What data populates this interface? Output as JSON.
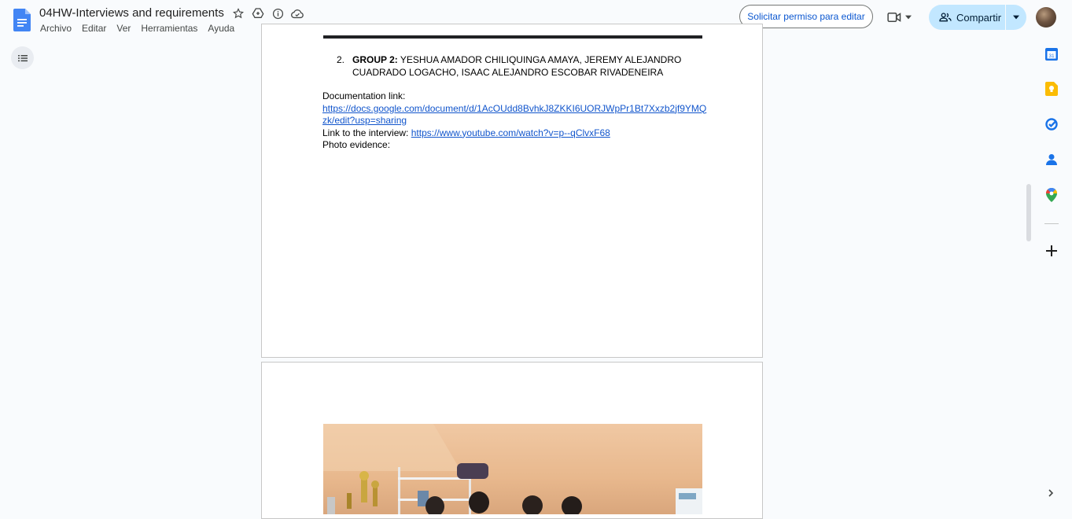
{
  "doc": {
    "title": "04HW-Interviews and requirements"
  },
  "menu": [
    "Archivo",
    "Editar",
    "Ver",
    "Herramientas",
    "Ayuda"
  ],
  "toolbar": {
    "request_edit_label": "Solicitar permiso para editar",
    "share_label": "Compartir"
  },
  "content": {
    "list_number": "2.",
    "group_label": "GROUP 2:",
    "group_members": "YESHUA AMADOR CHILIQUINGA AMAYA, JEREMY ALEJANDRO CUADRADO LOGACHO, ISAAC ALEJANDRO ESCOBAR RIVADENEIRA",
    "documentation_label": "Documentation link:",
    "documentation_url_line1": "https://docs.google.com/document/d/1AcOUdd8BvhkJ8ZKKI6UORJWpPr1Bt7Xxzb2jf9YMQ",
    "documentation_url_line2": "zk/edit?usp=sharing",
    "interview_label": "Link to the interview:",
    "interview_url": "https://www.youtube.com/watch?v=p--qClvxF68",
    "photo_label": "Photo evidence:"
  },
  "colors": {
    "accent": "#0b57d0",
    "share_bg": "#c2e7ff",
    "link": "#1155cc",
    "background": "#f9fbfd"
  }
}
